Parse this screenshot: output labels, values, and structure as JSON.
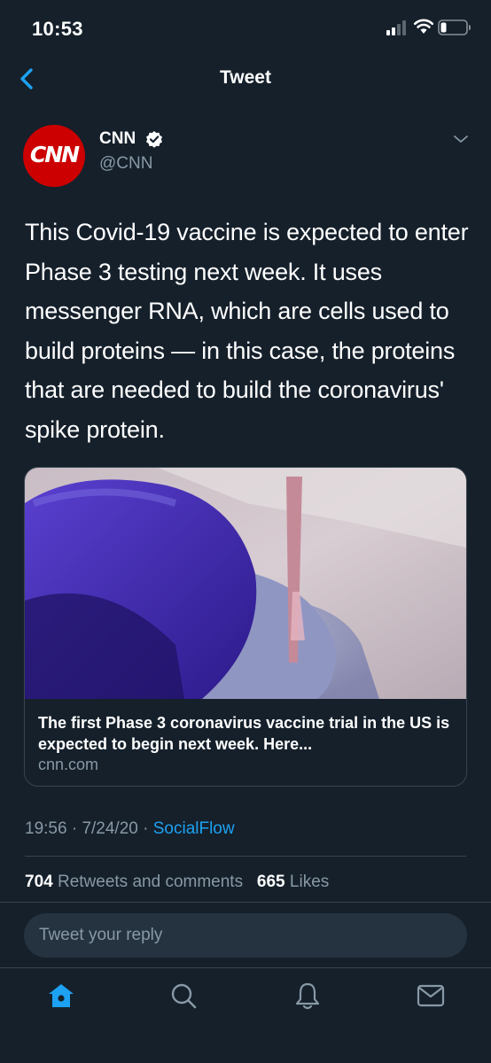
{
  "status_bar": {
    "time": "10:53",
    "icons": [
      "cellular-signal-icon",
      "wifi-icon",
      "battery-icon"
    ]
  },
  "nav": {
    "title": "Tweet",
    "back_icon": "chevron-left-icon"
  },
  "author": {
    "avatar_text": "CNN",
    "name": "CNN",
    "handle": "@CNN",
    "verified": true
  },
  "tweet": {
    "text": "This Covid-19 vaccine is expected to enter Phase 3 testing next week. It uses messenger RNA, which are cells used to build proteins — in this case, the proteins that are needed to build the coronavirus' spike protein."
  },
  "card": {
    "title": "The first Phase 3 coronavirus vaccine trial in the US is expected to begin next week. Here...",
    "domain": "cnn.com"
  },
  "meta": {
    "time": "19:56",
    "date": "7/24/20",
    "separator": "·",
    "source": "SocialFlow"
  },
  "stats": {
    "retweets_count": "704",
    "retweets_label": "Retweets and comments",
    "likes_count": "665",
    "likes_label": "Likes"
  },
  "reply": {
    "placeholder": "Tweet your reply"
  },
  "tab_bar": {
    "tabs": [
      "home-icon",
      "search-icon",
      "notifications-icon",
      "messages-icon"
    ],
    "active": "home-icon"
  },
  "colors": {
    "background": "#15202b",
    "accent": "#1da1f2",
    "secondary_text": "#8899a6",
    "border": "#38444d",
    "cnn_red": "#cc0000"
  }
}
